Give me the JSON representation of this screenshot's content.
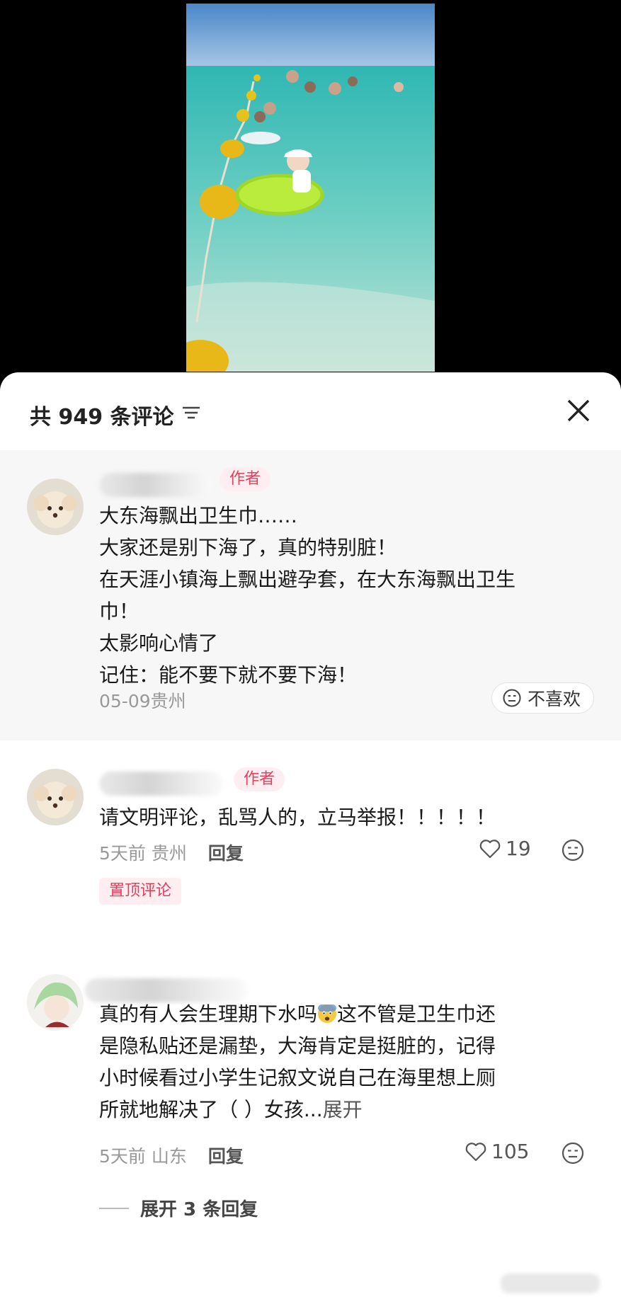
{
  "panel": {
    "comment_count": "共 949 条评论"
  },
  "comments": [
    {
      "tag": "作者",
      "lines": [
        "大东海飘出卫生巾……",
        "大家还是别下海了，真的特别脏！",
        "在天涯小镇海上飘出避孕套，在大东海飘出卫生",
        "巾！",
        "太影响心情了",
        "记住：能不要下就不要下海！"
      ],
      "meta": "05-09贵州",
      "dislike_label": "不喜欢"
    },
    {
      "tag": "作者",
      "text": "请文明评论，乱骂人的，立马举报！！！！！",
      "time": "5天前",
      "location": "贵州",
      "reply_label": "回复",
      "likes": "19",
      "pinned_label": "置顶评论"
    },
    {
      "lines": [
        "真的有人会生理期下水吗",
        "这不管是卫生巾还",
        "是隐私贴还是漏垫，大海肯定是挺脏的，记得",
        "小时候看过小学生记叙文说自己在海里想上厕",
        "所就地解决了（ ）女孩..."
      ],
      "expand_label": "展开",
      "time": "5天前",
      "location": "山东",
      "reply_label": "回复",
      "likes": "105",
      "replies_label": "展开 3 条回复"
    }
  ],
  "icons": {
    "sort": "sort-lines-icon",
    "close": "close-icon",
    "heart": "heart-outline-icon",
    "dislike": "dislike-face-icon",
    "emoji": "fearful-face-emoji"
  },
  "colors": {
    "accent": "#e0405e",
    "tag_bg": "#ffeef1",
    "highlight_bg": "#f7f7f7"
  }
}
